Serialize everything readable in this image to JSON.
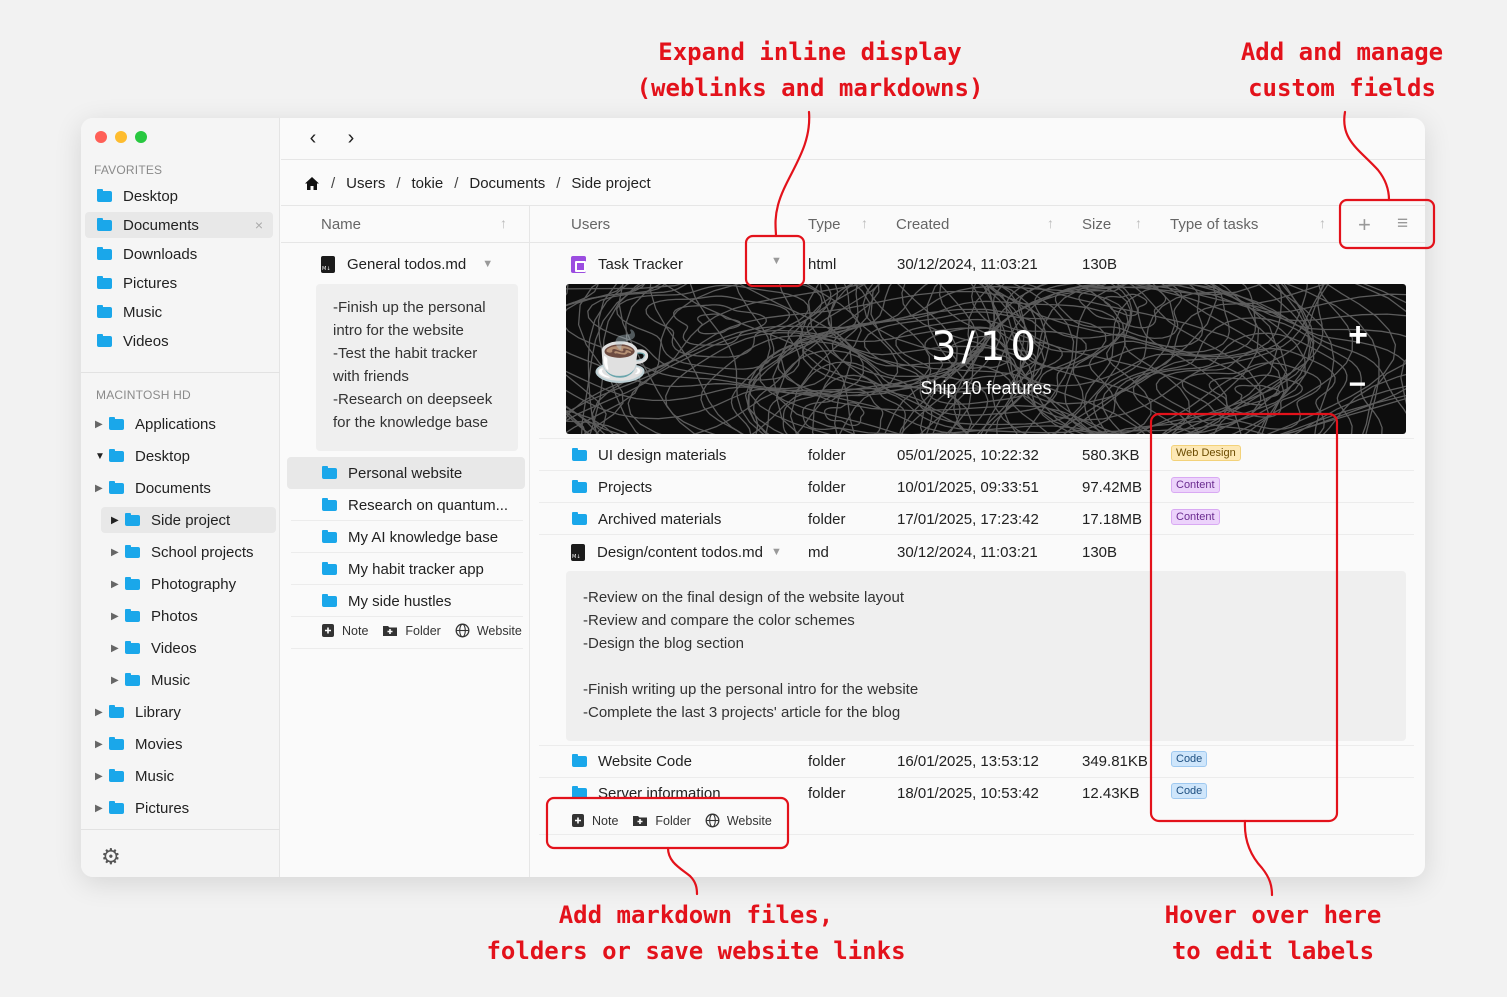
{
  "callouts": {
    "expand_1": "Expand inline display",
    "expand_2": "(weblinks and markdowns)",
    "add_fields_1": "Add and manage",
    "add_fields_2": "custom fields",
    "add_md_1": "Add markdown files,",
    "add_md_2": "folders or save website links",
    "hover_1": "Hover over here",
    "hover_2": "to edit labels"
  },
  "window": {
    "traffic_colors": [
      "#ff5f57",
      "#febc2e",
      "#28c840"
    ]
  },
  "sidebar": {
    "favorites_title": "FAVORITES",
    "favorites": [
      {
        "label": "Desktop"
      },
      {
        "label": "Documents",
        "close": "×"
      },
      {
        "label": "Downloads"
      },
      {
        "label": "Pictures"
      },
      {
        "label": "Music"
      },
      {
        "label": "Videos"
      }
    ],
    "disk_title": "MACINTOSH HD",
    "tree": [
      {
        "label": "Applications",
        "arrow": "▶"
      },
      {
        "label": "Desktop",
        "arrow": "▼"
      },
      {
        "label": "Documents",
        "arrow": "▶"
      },
      {
        "label": "Side project",
        "arrow": "▶"
      },
      {
        "label": "School projects",
        "arrow": "▶"
      },
      {
        "label": "Photography",
        "arrow": "▶"
      },
      {
        "label": "Photos",
        "arrow": "▶"
      },
      {
        "label": "Videos",
        "arrow": "▶"
      },
      {
        "label": "Music",
        "arrow": "▶"
      },
      {
        "label": "Library",
        "arrow": "▶"
      },
      {
        "label": "Movies",
        "arrow": "▶"
      },
      {
        "label": "Music",
        "arrow": "▶"
      },
      {
        "label": "Pictures",
        "arrow": "▶"
      }
    ],
    "settings_icon": "gear-icon"
  },
  "nav": {
    "back": "‹",
    "forward": "›"
  },
  "breadcrumb": {
    "items": [
      "Users",
      "tokie",
      "Documents",
      "Side project"
    ],
    "separator": "/"
  },
  "left_pane": {
    "header": "Name",
    "file": "General todos.md",
    "file_note": "-Finish up the personal\nintro for the website\n-Test the habit tracker\nwith friends\n-Research on deepseek\nfor the knowledge base",
    "folders": [
      "Personal website",
      "Research on quantum...",
      "My AI knowledge base",
      "My habit tracker app",
      "My side hustles"
    ],
    "add_note": "Note",
    "add_folder": "Folder",
    "add_website": "Website"
  },
  "right_pane": {
    "headers": {
      "users": "Users",
      "type": "Type",
      "created": "Created",
      "size": "Size",
      "tasks": "Type of tasks"
    },
    "add_field": "+",
    "manage_fields": "≡",
    "task_tracker": {
      "name": "Task Tracker",
      "type": "html",
      "created": "30/12/2024, 11:03:21",
      "size": "130B"
    },
    "banner": {
      "count": "3/10",
      "label": "Ship 10 features",
      "plus": "+",
      "minus": "−"
    },
    "rows1": [
      {
        "name": "UI design materials",
        "type": "folder",
        "created": "05/01/2025, 10:22:32",
        "size": "580.3KB",
        "tag": "Web Design"
      },
      {
        "name": "Projects",
        "type": "folder",
        "created": "10/01/2025, 09:33:51",
        "size": "97.42MB",
        "tag": "Content"
      },
      {
        "name": "Archived materials",
        "type": "folder",
        "created": "17/01/2025, 17:23:42",
        "size": "17.18MB",
        "tag": "Content"
      }
    ],
    "md_file": {
      "name": "Design/content todos.md",
      "type": "md",
      "created": "30/12/2024, 11:03:21",
      "size": "130B"
    },
    "md_note": "-Review on the final design of the website layout\n-Review and compare the color schemes\n-Design the blog section\n\n-Finish writing up the personal intro for the website\n-Complete the last 3 projects' article for the blog",
    "rows2": [
      {
        "name": "Website Code",
        "type": "folder",
        "created": "16/01/2025, 13:53:12",
        "size": "349.81KB",
        "tag": "Code"
      },
      {
        "name": "Server information",
        "type": "folder",
        "created": "18/01/2025, 10:53:42",
        "size": "12.43KB",
        "tag": "Code"
      }
    ],
    "add_note": "Note",
    "add_folder": "Folder",
    "add_website": "Website"
  },
  "tag_colors": {
    "Web Design": {
      "bg": "#fde8b5",
      "fg": "#6b4b00",
      "border": "#f3d27a"
    },
    "Content": {
      "bg": "#ecd3fb",
      "fg": "#6a2b8f",
      "border": "#d9a9f3"
    },
    "Code": {
      "bg": "#cfe6fb",
      "fg": "#1d4f80",
      "border": "#9fc9f0"
    }
  },
  "accent_color": "#e3121b"
}
